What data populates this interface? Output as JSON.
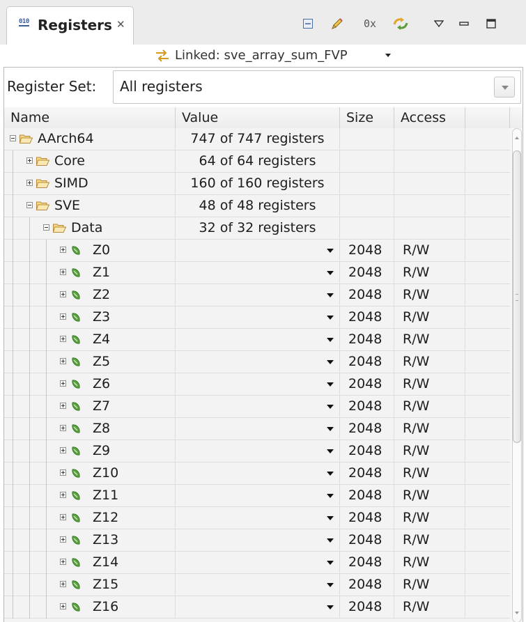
{
  "view": {
    "tab_title": "Registers",
    "tab_icon_text": "010",
    "toolbar_hex": "0x",
    "linked_text": "Linked: sve_array_sum_FVP"
  },
  "register_set": {
    "label": "Register Set:",
    "value": "All registers"
  },
  "columns": {
    "name": "Name",
    "value": "Value",
    "size": "Size",
    "access": "Access"
  },
  "tree": [
    {
      "name": "AArch64",
      "value": "747 of 747 registers",
      "level": 0,
      "type": "folder",
      "expanded": true
    },
    {
      "name": "Core",
      "value": "64 of 64 registers",
      "level": 1,
      "type": "folder",
      "expanded": false
    },
    {
      "name": "SIMD",
      "value": "160 of 160 registers",
      "level": 1,
      "type": "folder",
      "expanded": false
    },
    {
      "name": "SVE",
      "value": "48 of 48 registers",
      "level": 1,
      "type": "folder",
      "expanded": true
    },
    {
      "name": "Data",
      "value": "32 of 32 registers",
      "level": 2,
      "type": "folder",
      "expanded": true
    },
    {
      "name": "Z0",
      "size": "2048",
      "access": "R/W",
      "level": 3,
      "type": "reg"
    },
    {
      "name": "Z1",
      "size": "2048",
      "access": "R/W",
      "level": 3,
      "type": "reg"
    },
    {
      "name": "Z2",
      "size": "2048",
      "access": "R/W",
      "level": 3,
      "type": "reg"
    },
    {
      "name": "Z3",
      "size": "2048",
      "access": "R/W",
      "level": 3,
      "type": "reg"
    },
    {
      "name": "Z4",
      "size": "2048",
      "access": "R/W",
      "level": 3,
      "type": "reg"
    },
    {
      "name": "Z5",
      "size": "2048",
      "access": "R/W",
      "level": 3,
      "type": "reg"
    },
    {
      "name": "Z6",
      "size": "2048",
      "access": "R/W",
      "level": 3,
      "type": "reg"
    },
    {
      "name": "Z7",
      "size": "2048",
      "access": "R/W",
      "level": 3,
      "type": "reg"
    },
    {
      "name": "Z8",
      "size": "2048",
      "access": "R/W",
      "level": 3,
      "type": "reg"
    },
    {
      "name": "Z9",
      "size": "2048",
      "access": "R/W",
      "level": 3,
      "type": "reg"
    },
    {
      "name": "Z10",
      "size": "2048",
      "access": "R/W",
      "level": 3,
      "type": "reg"
    },
    {
      "name": "Z11",
      "size": "2048",
      "access": "R/W",
      "level": 3,
      "type": "reg"
    },
    {
      "name": "Z12",
      "size": "2048",
      "access": "R/W",
      "level": 3,
      "type": "reg"
    },
    {
      "name": "Z13",
      "size": "2048",
      "access": "R/W",
      "level": 3,
      "type": "reg"
    },
    {
      "name": "Z14",
      "size": "2048",
      "access": "R/W",
      "level": 3,
      "type": "reg"
    },
    {
      "name": "Z15",
      "size": "2048",
      "access": "R/W",
      "level": 3,
      "type": "reg"
    },
    {
      "name": "Z16",
      "size": "2048",
      "access": "R/W",
      "level": 3,
      "type": "reg"
    }
  ],
  "colors": {
    "folder_fill": "#f5d98b",
    "folder_stroke": "#b8893a",
    "register_green": "#5aa33c",
    "accent_blue": "#3b5e9a"
  }
}
